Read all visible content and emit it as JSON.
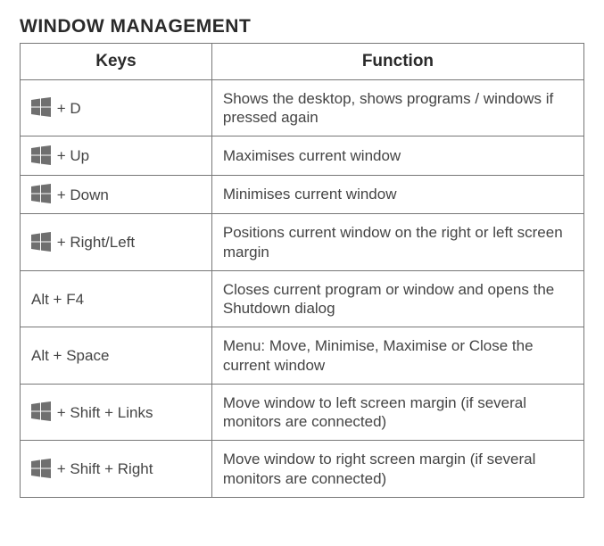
{
  "title": "WINDOW MANAGEMENT",
  "headers": {
    "keys": "Keys",
    "function": "Function"
  },
  "icons": {
    "windows": "windows-logo"
  },
  "rows": [
    {
      "winIcon": true,
      "keys": " + D",
      "function": "Shows the desktop, shows programs / windows if pressed again"
    },
    {
      "winIcon": true,
      "keys": " + Up",
      "function": "Maximises current window"
    },
    {
      "winIcon": true,
      "keys": " + Down",
      "function": "Minimises current window"
    },
    {
      "winIcon": true,
      "keys": " + Right/Left",
      "function": "Positions current window on the right or left screen margin"
    },
    {
      "winIcon": false,
      "keys": "Alt + F4",
      "function": "Closes current program or window and opens the Shutdown dialog"
    },
    {
      "winIcon": false,
      "keys": "Alt + Space",
      "function": "Menu: Move, Minimise, Maximise or Close the current window"
    },
    {
      "winIcon": true,
      "keys": " + Shift + Links",
      "function": "Move window to left screen margin (if several monitors are connected)"
    },
    {
      "winIcon": true,
      "keys": " + Shift + Right",
      "function": "Move window to right screen margin (if several monitors are connected)"
    }
  ]
}
